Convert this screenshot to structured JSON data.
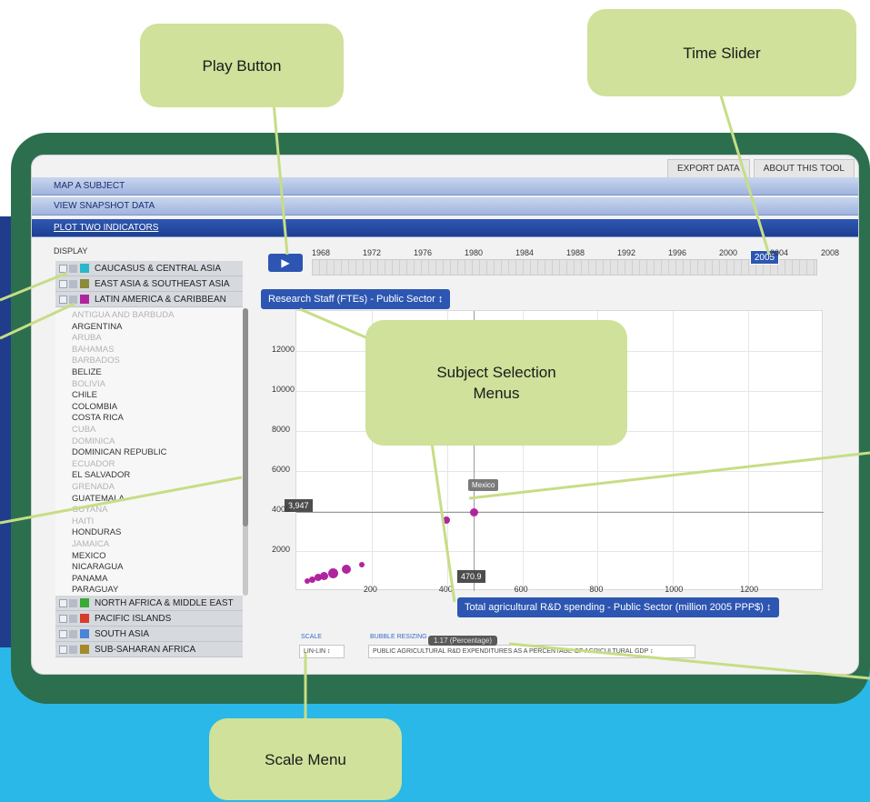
{
  "callouts": {
    "play_button": "Play Button",
    "time_slider": "Time Slider",
    "subject_selection": "Subject Selection\nMenus",
    "scale_menu": "Scale Menu"
  },
  "tabs": {
    "export": "EXPORT DATA",
    "about": "ABOUT THIS TOOL"
  },
  "nav": {
    "map": "MAP A SUBJECT",
    "snapshot": "VIEW SNAPSHOT DATA",
    "plot": "PLOT TWO INDICATORS"
  },
  "display_label": "DISPLAY",
  "regions": [
    {
      "name": "CAUCASUS & CENTRAL ASIA",
      "color": "#2ab6c9"
    },
    {
      "name": "EAST ASIA & SOUTHEAST ASIA",
      "color": "#8c8a3b"
    },
    {
      "name": "LATIN AMERICA & CARIBBEAN",
      "color": "#b0259f"
    },
    {
      "name": "NORTH AFRICA & MIDDLE EAST",
      "color": "#3aa935"
    },
    {
      "name": "PACIFIC ISLANDS",
      "color": "#d83b2c"
    },
    {
      "name": "SOUTH ASIA",
      "color": "#4a84d6"
    },
    {
      "name": "SUB-SAHARAN AFRICA",
      "color": "#a58a2c"
    }
  ],
  "countries": [
    {
      "name": "ANTIGUA AND BARBUDA",
      "dim": true
    },
    {
      "name": "ARGENTINA",
      "dim": false
    },
    {
      "name": "ARUBA",
      "dim": true
    },
    {
      "name": "BAHAMAS",
      "dim": true
    },
    {
      "name": "BARBADOS",
      "dim": true
    },
    {
      "name": "BELIZE",
      "dim": false
    },
    {
      "name": "BOLIVIA",
      "dim": true
    },
    {
      "name": "CHILE",
      "dim": false
    },
    {
      "name": "COLOMBIA",
      "dim": false
    },
    {
      "name": "COSTA RICA",
      "dim": false
    },
    {
      "name": "CUBA",
      "dim": true
    },
    {
      "name": "DOMINICA",
      "dim": true
    },
    {
      "name": "DOMINICAN REPUBLIC",
      "dim": false
    },
    {
      "name": "ECUADOR",
      "dim": true
    },
    {
      "name": "EL SALVADOR",
      "dim": false
    },
    {
      "name": "GRENADA",
      "dim": true
    },
    {
      "name": "GUATEMALA",
      "dim": false
    },
    {
      "name": "GUYANA",
      "dim": true
    },
    {
      "name": "HAITI",
      "dim": true
    },
    {
      "name": "HONDURAS",
      "dim": false
    },
    {
      "name": "JAMAICA",
      "dim": true
    },
    {
      "name": "MEXICO",
      "dim": false
    },
    {
      "name": "NICARAGUA",
      "dim": false
    },
    {
      "name": "PANAMA",
      "dim": false
    },
    {
      "name": "PARAGUAY",
      "dim": false
    }
  ],
  "play_icon": "play-icon",
  "timeline": {
    "years": [
      "1968",
      "1972",
      "1976",
      "1980",
      "1984",
      "1988",
      "1992",
      "1996",
      "2000",
      "2004",
      "2008"
    ],
    "current": "2005"
  },
  "y_menu": "Research Staff (FTEs) - Public Sector  ↕",
  "x_menu": "Total agricultural R&D spending - Public Sector (million 2005 PPP$)  ↕",
  "readouts": {
    "y": "3,947",
    "x": "470.9"
  },
  "highlight_label": "Mexico",
  "chart_data": {
    "type": "scatter",
    "xticks": [
      200,
      400,
      600,
      800,
      1000,
      1200
    ],
    "xtick_labels": [
      "200",
      "400",
      "600",
      "800",
      "1000",
      "1200"
    ],
    "yticks": [
      2000,
      4000,
      6000,
      8000,
      10000,
      12000
    ],
    "ytick_labels": [
      "2000",
      "4000",
      "6000",
      "8000",
      "10000",
      "12000"
    ],
    "xlim": [
      0,
      1400
    ],
    "ylim": [
      0,
      14000
    ],
    "points": [
      {
        "x": 470.9,
        "y": 3947,
        "size": 9,
        "label": "Mexico"
      },
      {
        "x": 398,
        "y": 3550,
        "size": 8
      },
      {
        "x": 132,
        "y": 1100,
        "size": 10
      },
      {
        "x": 174,
        "y": 1330,
        "size": 6
      },
      {
        "x": 98,
        "y": 880,
        "size": 11
      },
      {
        "x": 74,
        "y": 760,
        "size": 9
      },
      {
        "x": 58,
        "y": 660,
        "size": 8
      },
      {
        "x": 42,
        "y": 580,
        "size": 7
      },
      {
        "x": 30,
        "y": 520,
        "size": 6
      }
    ]
  },
  "scale": {
    "title": "SCALE",
    "value": "LIN-LIN ↕"
  },
  "bubble": {
    "title": "BUBBLE RESIZING",
    "value": "PUBLIC AGRICULTURAL R&D EXPENDITURES AS A PERCENTAGE OF AGRICULTURAL GDP ↕",
    "tooltip": "1.17 (Percentage)"
  }
}
